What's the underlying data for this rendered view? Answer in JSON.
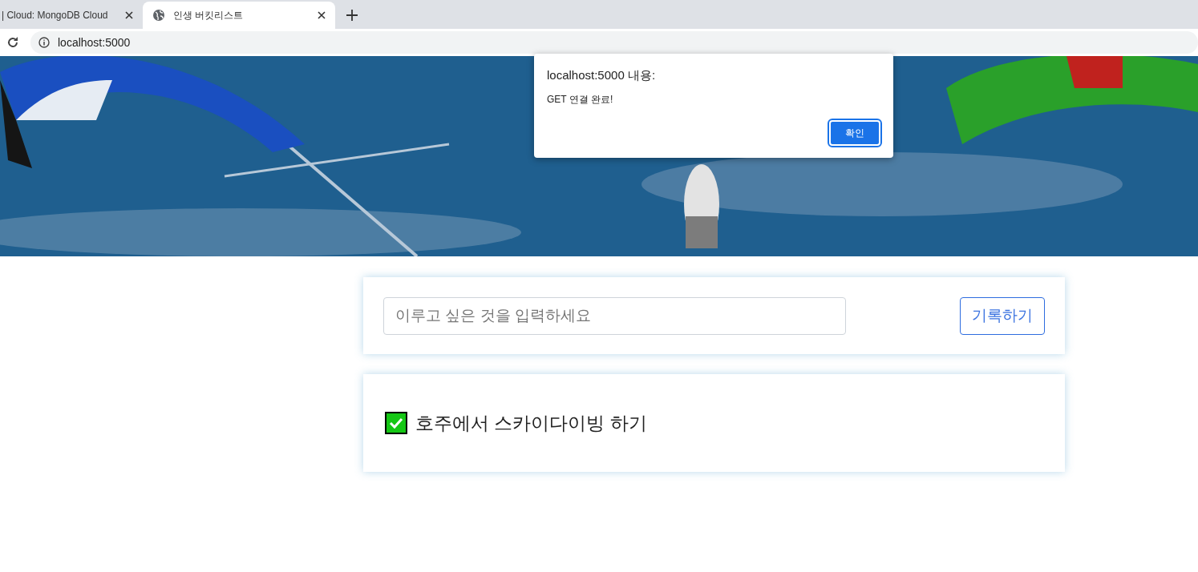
{
  "browser": {
    "tabs": [
      {
        "title": "| Cloud: MongoDB Cloud",
        "selected": false
      },
      {
        "title": "인생 버킷리스트",
        "selected": true
      }
    ],
    "address": "localhost:5000"
  },
  "dialog": {
    "title": "localhost:5000 내용:",
    "message": "GET 연결 완료!",
    "button": "확인"
  },
  "form": {
    "placeholder": "이루고 싶은 것을 입력하세요",
    "button": "기록하기"
  },
  "items": [
    {
      "text": "호주에서 스카이다이빙 하기",
      "done": true
    }
  ]
}
